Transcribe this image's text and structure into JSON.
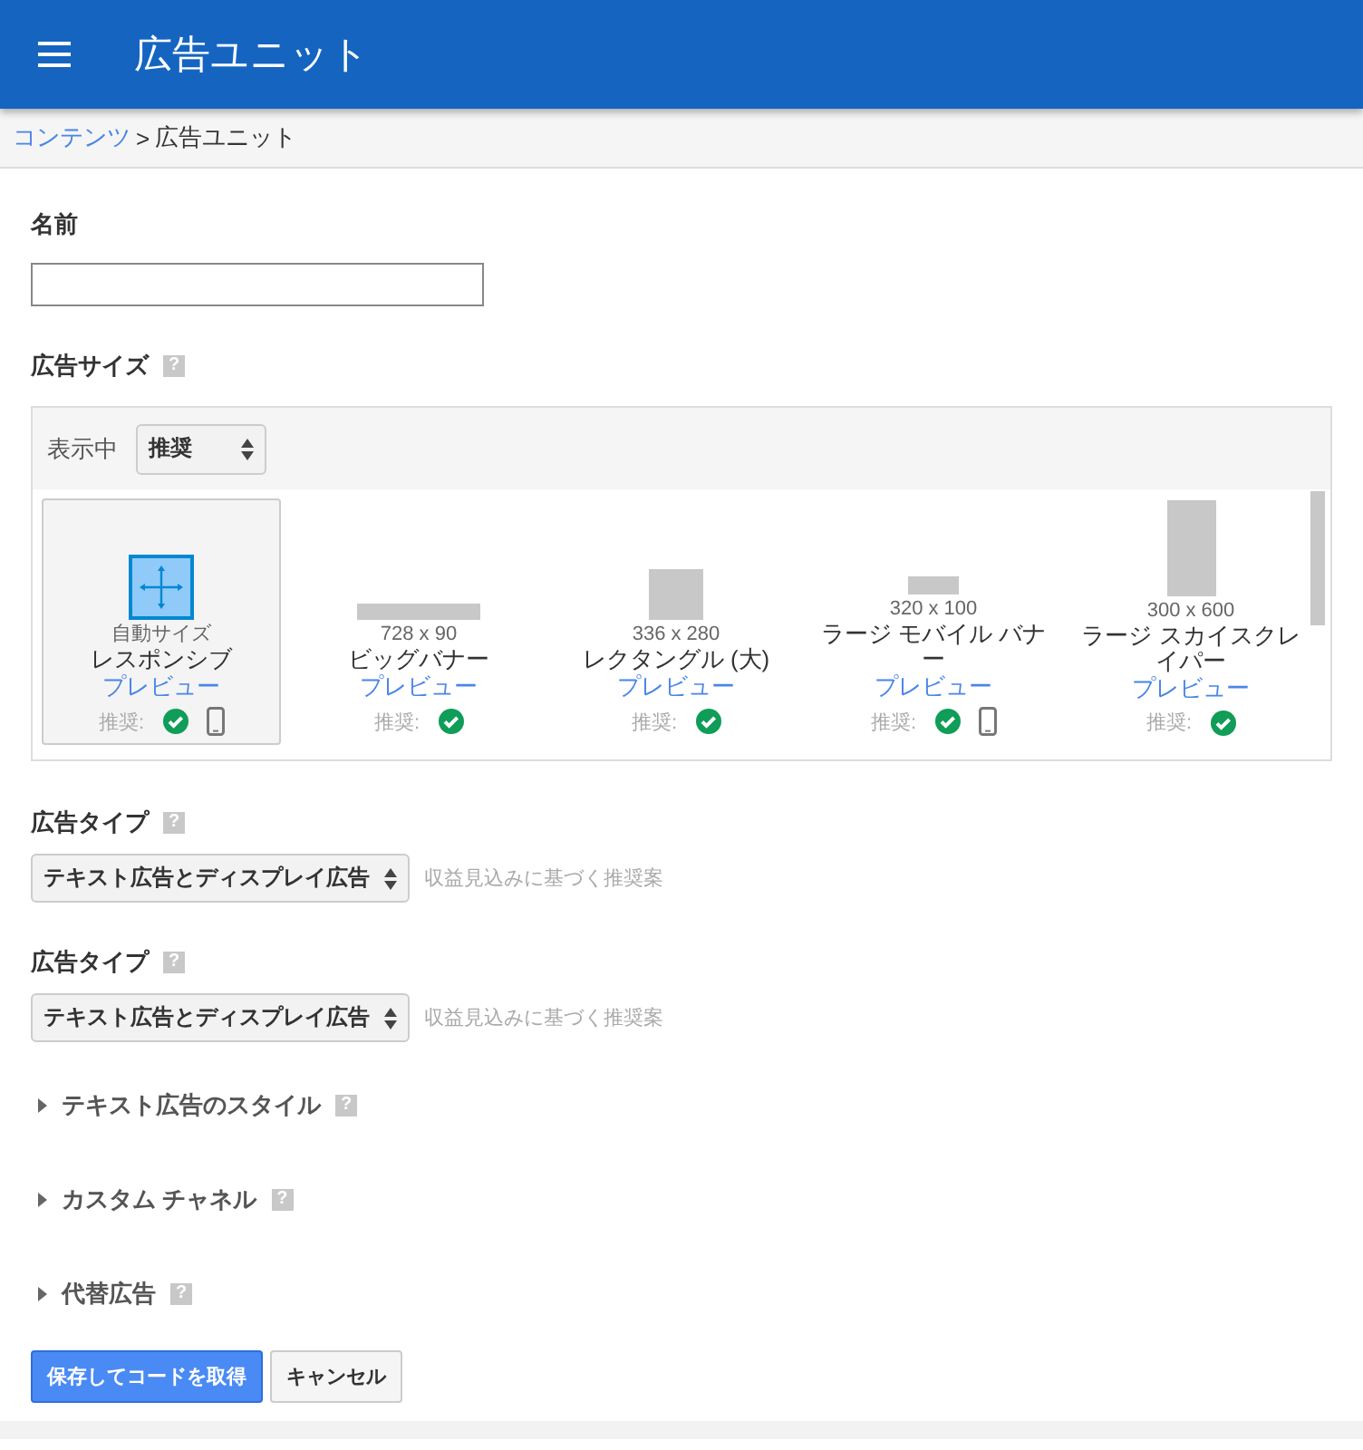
{
  "app_bar": {
    "title": "広告ユニット"
  },
  "breadcrumb": {
    "link": "コンテンツ",
    "separator": ">",
    "current": "広告ユニット"
  },
  "name_field": {
    "label": "名前"
  },
  "ad_size": {
    "label": "広告サイズ",
    "help": "?",
    "filter_label": "表示中",
    "filter_value": "推奨",
    "cards": [
      {
        "kind": "responsive",
        "size": "自動サイズ",
        "name": "レスポンシブ",
        "preview": "プレビュー",
        "recommended": "推奨:",
        "mobile": true,
        "selected": true
      },
      {
        "kind": "leaderboard",
        "size": "728 x 90",
        "name": "ビッグバナー",
        "preview": "プレビュー",
        "recommended": "推奨:",
        "mobile": false,
        "selected": false
      },
      {
        "kind": "rectangle",
        "size": "336 x 280",
        "name": "レクタングル (大)",
        "preview": "プレビュー",
        "recommended": "推奨:",
        "mobile": false,
        "selected": false
      },
      {
        "kind": "mobile-banner",
        "size": "320 x 100",
        "name": "ラージ モバイル バナー",
        "preview": "プレビュー",
        "recommended": "推奨:",
        "mobile": true,
        "selected": false
      },
      {
        "kind": "skyscraper",
        "size": "300 x 600",
        "name": "ラージ スカイスクレイパー",
        "preview": "プレビュー",
        "recommended": "推奨:",
        "mobile": false,
        "selected": false
      }
    ]
  },
  "ad_types": [
    {
      "label": "広告タイプ",
      "help": "?",
      "value": "テキスト広告とディスプレイ広告",
      "hint": "収益見込みに基づく推奨案"
    },
    {
      "label": "広告タイプ",
      "help": "?",
      "value": "テキスト広告とディスプレイ広告",
      "hint": "収益見込みに基づく推奨案"
    }
  ],
  "sections": [
    {
      "label": "テキスト広告のスタイル",
      "help": "?",
      "expanded": false
    },
    {
      "label": "カスタム チャネル",
      "help": "?",
      "expanded": false
    },
    {
      "label": "代替広告",
      "help": "?",
      "expanded": false
    }
  ],
  "buttons": [
    {
      "label": "保存してコードを取得",
      "kind": "primary"
    },
    {
      "label": "キャンセル",
      "kind": "secondary"
    }
  ]
}
